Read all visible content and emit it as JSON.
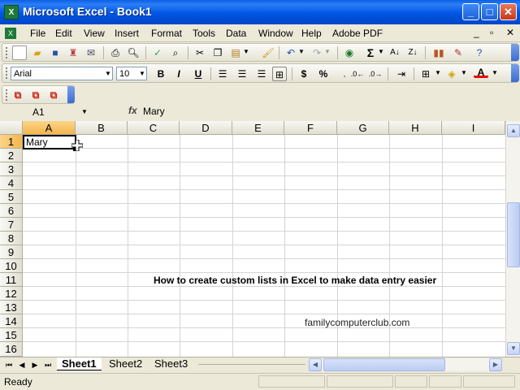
{
  "window": {
    "title": "Microsoft Excel - Book1",
    "app_icon": "excel-icon"
  },
  "menu": [
    "File",
    "Edit",
    "View",
    "Insert",
    "Format",
    "Tools",
    "Data",
    "Window",
    "Help",
    "Adobe PDF"
  ],
  "formatting": {
    "font_name": "Arial",
    "font_size": "10",
    "bold": "B",
    "italic": "I",
    "underline": "U",
    "currency": "$",
    "percent": "%"
  },
  "formula_bar": {
    "name_box": "A1",
    "fx": "fx",
    "value": "Mary"
  },
  "columns": [
    "A",
    "B",
    "C",
    "D",
    "E",
    "F",
    "G",
    "H",
    "I"
  ],
  "rows": [
    "1",
    "2",
    "3",
    "4",
    "5",
    "6",
    "7",
    "8",
    "9",
    "10",
    "11",
    "12",
    "13",
    "14",
    "15",
    "16"
  ],
  "cells": {
    "A1": "Mary"
  },
  "overlay": {
    "caption": "How to create custom lists in Excel to make data entry easier",
    "site": "familycomputerclub.com"
  },
  "sheet_tabs": [
    "Sheet1",
    "Sheet2",
    "Sheet3"
  ],
  "active_sheet": "Sheet1",
  "status": "Ready",
  "colors": {
    "titlebar": "#0055e3",
    "selected_header": "#f4b54b",
    "chrome": "#ece9d8"
  }
}
